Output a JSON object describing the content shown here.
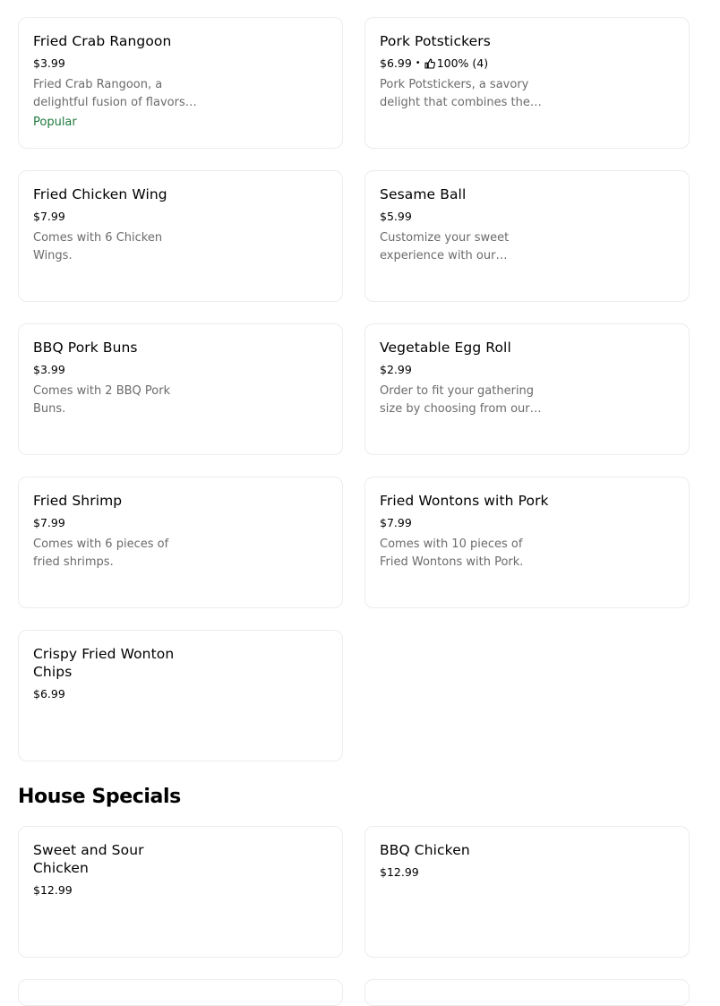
{
  "menu_items": [
    {
      "title": "Fried Crab Rangoon",
      "price": "$3.99",
      "description": "Fried Crab Rangoon, a delightful fusion of flavors…",
      "badge": "Popular"
    },
    {
      "title": "Pork Potstickers",
      "price": "$6.99",
      "rating_separator": "•",
      "rating": "100% (4)",
      "rating_icon": "thumbs-up-icon",
      "description": "Pork Potstickers, a savory delight that combines the…"
    },
    {
      "title": "Fried Chicken Wing",
      "price": "$7.99",
      "description": "Comes with 6 Chicken Wings."
    },
    {
      "title": "Sesame Ball",
      "price": "$5.99",
      "description": "Customize your sweet experience with our Sesam…"
    },
    {
      "title": "BBQ Pork Buns",
      "price": "$3.99",
      "description": "Comes with 2 BBQ Pork Buns."
    },
    {
      "title": "Vegetable Egg Roll",
      "price": "$2.99",
      "description": "Order to fit your gathering size by choosing from our…"
    },
    {
      "title": "Fried Shrimp",
      "price": "$7.99",
      "description": "Comes with 6 pieces of fried shrimps."
    },
    {
      "title": "Fried Wontons with Pork",
      "price": "$7.99",
      "description": "Comes with 10 pieces of Fried Wontons with Pork."
    },
    {
      "title": "Crispy Fried Wonton Chips",
      "price": "$6.99"
    }
  ],
  "house_specials": {
    "heading": "House Specials",
    "items": [
      {
        "title": "Sweet and Sour Chicken",
        "price": "$12.99"
      },
      {
        "title": "BBQ Chicken",
        "price": "$12.99"
      }
    ]
  },
  "colors": {
    "badge_green": "#1e7a3c",
    "description_gray": "#6b6b6b",
    "card_border": "#ececec"
  }
}
